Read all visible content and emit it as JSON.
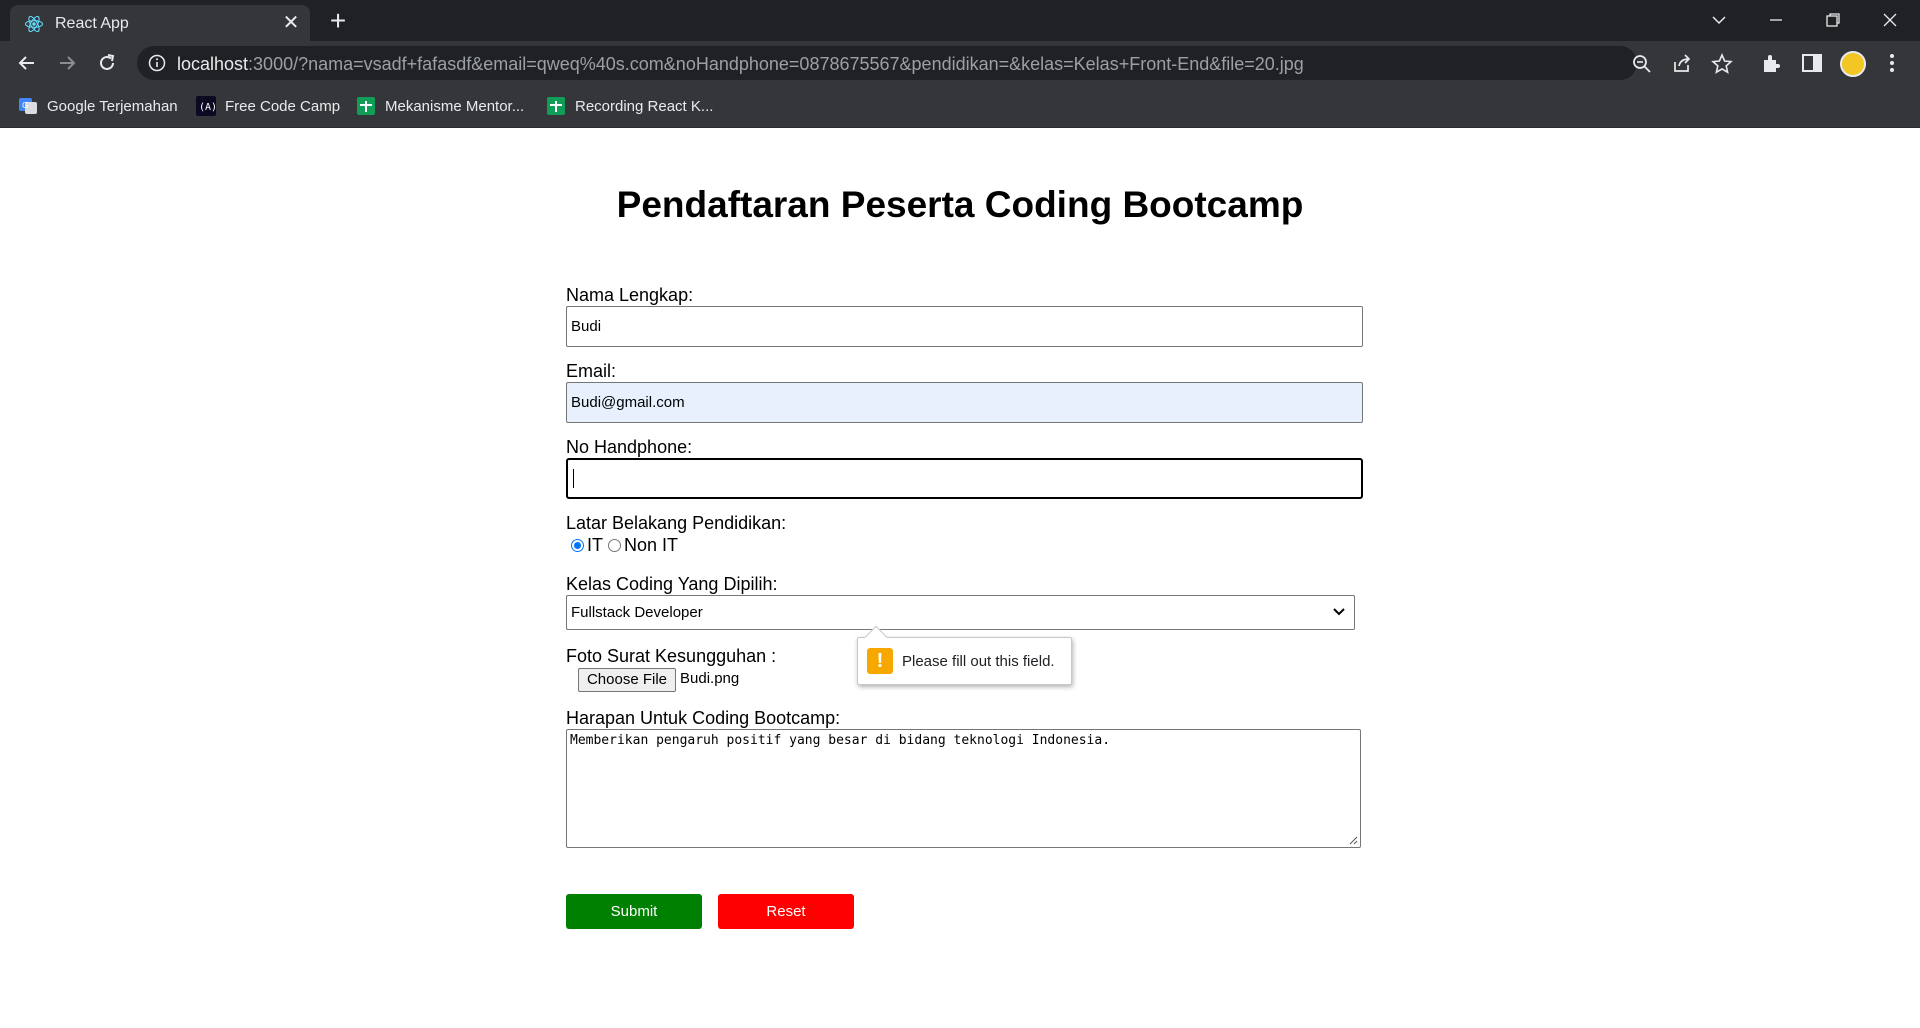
{
  "browser": {
    "tab_title": "React App",
    "url_host": "localhost",
    "url_rest": ":3000/?nama=vsadf+fafasdf&email=qweq%40s.com&noHandphone=0878675567&pendidikan=&kelas=Kelas+Front-End&file=20.jpg",
    "bookmarks": [
      {
        "label": "Google Terjemahan",
        "icon": "google-translate-icon"
      },
      {
        "label": "Free Code Camp",
        "icon": "freecodecamp-icon"
      },
      {
        "label": "Mekanisme Mentor...",
        "icon": "google-sheets-icon"
      },
      {
        "label": "Recording React K...",
        "icon": "google-sheets-icon"
      }
    ]
  },
  "form": {
    "title": "Pendaftaran Peserta Coding Bootcamp",
    "nama_label": "Nama Lengkap:",
    "nama_value": "Budi",
    "email_label": "Email:",
    "email_value": "Budi@gmail.com",
    "hp_label": "No Handphone:",
    "hp_value": "",
    "pendidikan_label": "Latar Belakang Pendidikan:",
    "pendidikan_options": [
      {
        "label": "IT",
        "checked": true
      },
      {
        "label": "Non IT",
        "checked": false
      }
    ],
    "kelas_label": "Kelas Coding Yang Dipilih:",
    "kelas_value": "Fullstack Developer",
    "foto_label": "Foto Surat Kesungguhan :",
    "file_button": "Choose File",
    "file_name": "Budi.png",
    "harapan_label": "Harapan Untuk Coding Bootcamp:",
    "harapan_value": "Memberikan pengaruh positif yang besar di bidang teknologi Indonesia.",
    "submit_label": "Submit",
    "reset_label": "Reset"
  },
  "validation": {
    "message": "Please fill out this field.",
    "icon": "warning-icon"
  },
  "colors": {
    "submit": "#008000",
    "reset": "#ff0000",
    "autofill": "#e8f0fe",
    "warning": "#f7a800"
  }
}
